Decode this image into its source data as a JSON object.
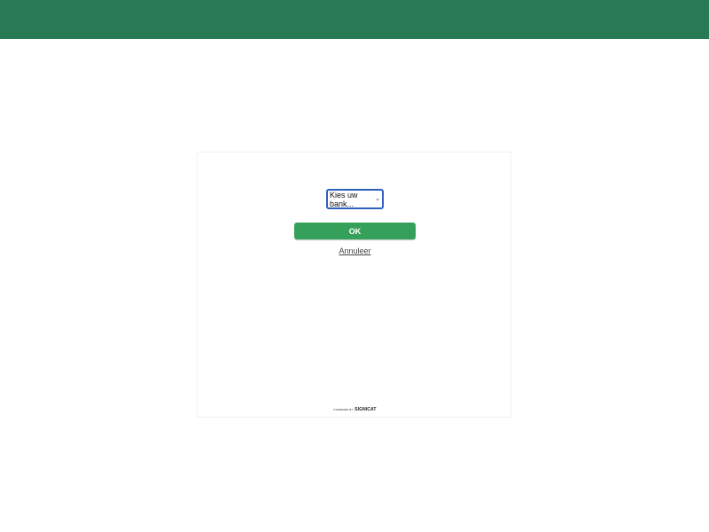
{
  "header": {
    "color": "#277a53"
  },
  "form": {
    "bank_select": {
      "selected": "Kies uw bank..."
    },
    "ok_label": "OK",
    "cancel_label": "Annuleer"
  },
  "footer": {
    "powered_by": "POWERED BY",
    "brand": "SIGNICAT"
  },
  "colors": {
    "accent": "#35a05a",
    "select_border": "#2f5fbf"
  }
}
